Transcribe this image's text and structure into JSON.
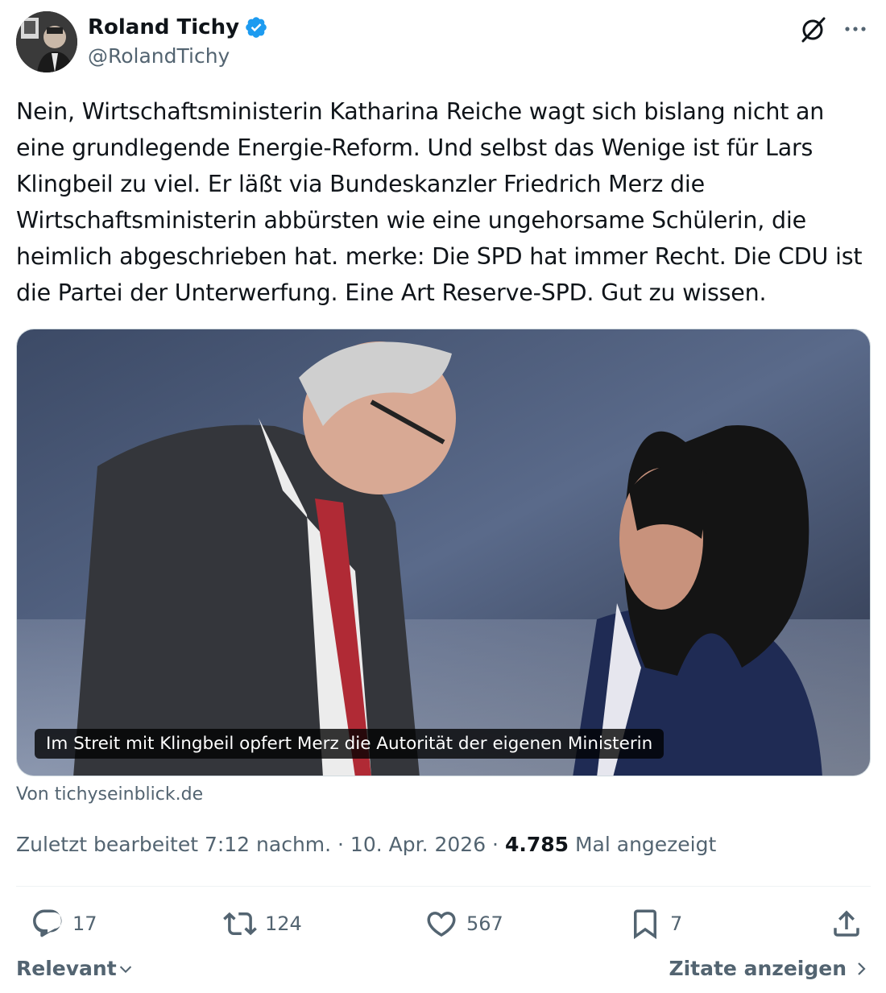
{
  "author": {
    "display_name": "Roland Tichy",
    "handle": "@RolandTichy",
    "verified": true
  },
  "tweet": {
    "text": "Nein, Wirtschaftsministerin Katharina Reiche wagt sich bislang nicht an eine grundlegende Energie-Reform. Und selbst das Wenige ist für Lars Klingbeil zu viel. Er läßt via Bundeskanzler Friedrich Merz die Wirtschaftsministerin abbürsten wie eine ungehorsame Schülerin, die heimlich abgeschrieben hat. merke: Die SPD hat immer Recht. Die CDU ist die Partei der Unterwerfung. Eine Art Reserve-SPD. Gut zu wissen."
  },
  "card": {
    "caption": "Im Streit mit Klingbeil opfert Merz die Autorität der eigenen Ministerin",
    "source": "Von tichyseinblick.de"
  },
  "meta": {
    "edited_prefix": "Zuletzt bearbeitet 7:12 nachm. · 10. Apr. 2026 · ",
    "views": "4.785",
    "views_suffix": " Mal angezeigt"
  },
  "actions": {
    "replies": "17",
    "reposts": "124",
    "likes": "567",
    "bookmarks": "7"
  },
  "footer": {
    "sort_label": "Relevant",
    "quotes_label": "Zitate anzeigen"
  },
  "colors": {
    "text": "#0f1419",
    "secondary": "#536471",
    "verified_blue": "#1d9bf0",
    "divider": "#eff3f4"
  },
  "icons": [
    "grok-icon",
    "more-icon",
    "verified-badge-icon",
    "reply-icon",
    "repost-icon",
    "like-icon",
    "bookmark-icon",
    "share-icon",
    "chevron-down-icon",
    "chevron-right-icon"
  ]
}
